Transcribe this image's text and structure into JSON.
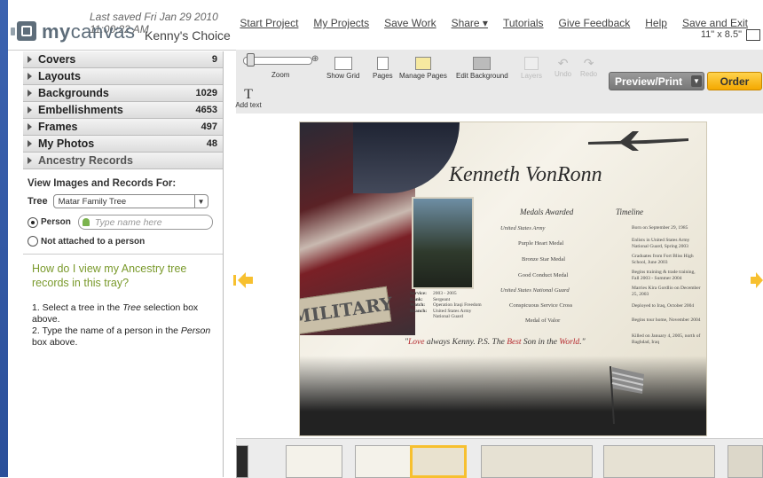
{
  "header": {
    "saved": "Last saved Fri Jan 29 2010 11:00:22 AM",
    "nav": [
      "Start Project",
      "My Projects",
      "Save Work",
      "Share ▾",
      "Tutorials",
      "Give Feedback",
      "Help",
      "Save and Exit"
    ],
    "logo_bold": "my",
    "logo_rest": "canvas",
    "project_name": "Kenny's Choice",
    "page_size": "11\" x 8.5\""
  },
  "sidebar": {
    "categories": [
      {
        "label": "Covers",
        "count": "9"
      },
      {
        "label": "Layouts",
        "count": ""
      },
      {
        "label": "Backgrounds",
        "count": "1029"
      },
      {
        "label": "Embellishments",
        "count": "4653"
      },
      {
        "label": "Frames",
        "count": "497"
      },
      {
        "label": "My Photos",
        "count": "48"
      },
      {
        "label": "Ancestry Records",
        "count": ""
      }
    ],
    "view_title": "View Images and Records For:",
    "tree_label": "Tree",
    "tree_value": "Matar Family Tree",
    "person_label": "Person",
    "person_placeholder": "Type name here",
    "not_attached_label": "Not attached to a person",
    "help_question": "How do I view my Ancestry tree records in this tray?",
    "step1_a": "1. Select a tree in the ",
    "step1_em": "Tree",
    "step1_b": " selection box above.",
    "step2_a": "2. Type the name of a person in the ",
    "step2_em": "Person",
    "step2_b": " box above."
  },
  "toolbar": {
    "zoom": "Zoom",
    "show_grid": "Show Grid",
    "pages": "Pages",
    "manage_pages": "Manage Pages",
    "edit_background": "Edit Background",
    "layers": "Layers",
    "undo": "Undo",
    "redo": "Redo",
    "add_text": "Add text",
    "add_text_glyph": "T",
    "preview_print": "Preview/Print",
    "order": "Order"
  },
  "page": {
    "name": "Kenneth VonRonn",
    "medals_title": "Medals Awarded",
    "medals": [
      "United States Army",
      "Purple Heart Medal",
      "Bronze Star Medal",
      "Good Conduct Medal",
      "United States National Guard",
      "Conspicuous Service Cross",
      "Medal of Valor"
    ],
    "timeline_title": "Timeline",
    "timeline": [
      "Born on September 29, 1985",
      "Enlists in United States Army National Guard, Spring 2003",
      "Graduates from Fort Bliss High School, June 2003",
      "Begins training & trade training, Fall 2003 - Summer 2004",
      "Marries Kira Gordlio on December 25, 2003",
      "Deployed to Iraq, October 2004",
      "Begins tour home, November 2004",
      "Killed on January 4, 2005, north of Baghdad, Iraq"
    ],
    "service_labels": "Service:\nRank:\nWatch:\nBranch:",
    "service_values": "2003 - 2005\nSergeant\nOperation Iraqi Freedom\nUnited States Army\nNational Guard",
    "sign_text": "MILITARY",
    "quote_1": "Love",
    "quote_2": " always Kenny. P.S. The ",
    "quote_3": "Best",
    "quote_4": " Son in the ",
    "quote_5": "World",
    "quote_6": ".\""
  },
  "colors": {
    "accent_green": "#7a9a2c",
    "order_button": "#f4a800",
    "preview_button": "#888888",
    "nav_arrow": "#f7c02f"
  }
}
